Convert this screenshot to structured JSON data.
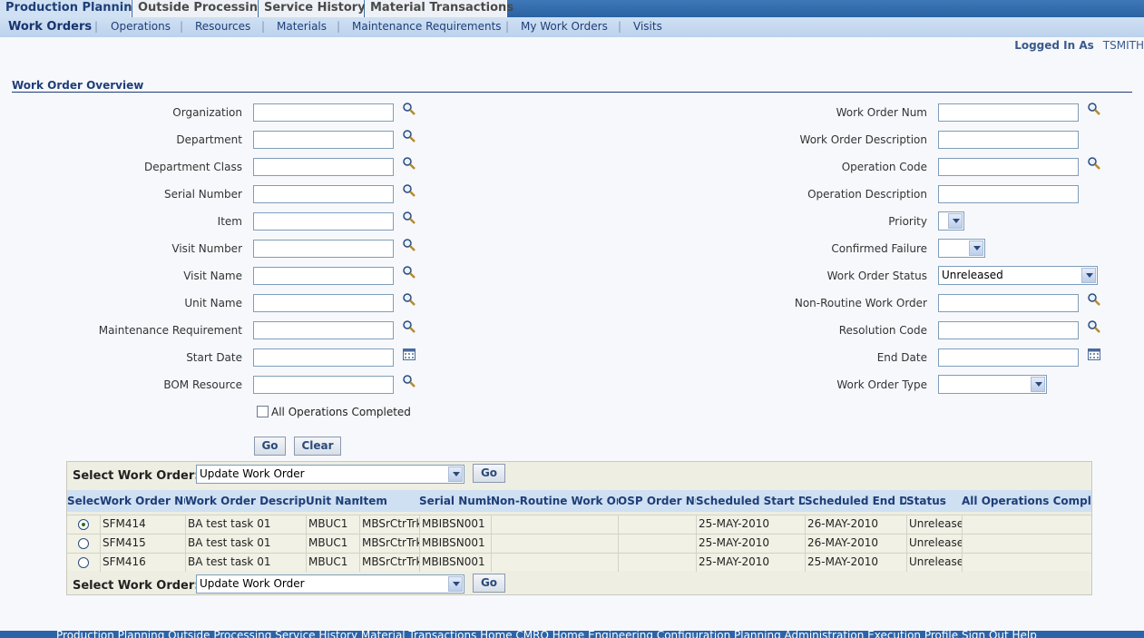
{
  "tabs": [
    {
      "label": "Production Planning",
      "active": true
    },
    {
      "label": "Outside Processing",
      "active": false
    },
    {
      "label": "Service History",
      "active": false
    },
    {
      "label": "Material Transactions",
      "active": false
    }
  ],
  "subnav": [
    "Work Orders",
    "Operations",
    "Resources",
    "Materials",
    "Maintenance Requirements",
    "My Work Orders",
    "Visits"
  ],
  "logged_in": {
    "label": "Logged In As",
    "user": "TSMITH"
  },
  "section_title": "Work Order Overview",
  "form_left": [
    {
      "label": "Organization",
      "icon": "search-icon"
    },
    {
      "label": "Department",
      "icon": "search-icon"
    },
    {
      "label": "Department Class",
      "icon": "search-icon"
    },
    {
      "label": "Serial Number",
      "icon": "search-icon"
    },
    {
      "label": "Item",
      "icon": "search-icon"
    },
    {
      "label": "Visit Number",
      "icon": "search-icon"
    },
    {
      "label": "Visit Name",
      "icon": "search-icon"
    },
    {
      "label": "Unit Name",
      "icon": "search-icon"
    },
    {
      "label": "Maintenance Requirement",
      "icon": "search-icon"
    },
    {
      "label": "Start Date",
      "icon": "calendar-icon"
    },
    {
      "label": "BOM Resource",
      "icon": "search-icon"
    }
  ],
  "form_right": {
    "work_order_num": "Work Order Num",
    "work_order_description": "Work Order Description",
    "operation_code": "Operation Code",
    "operation_description": "Operation Description",
    "priority": "Priority",
    "confirmed_failure": "Confirmed Failure",
    "work_order_status": "Work Order Status",
    "work_order_status_value": "Unreleased",
    "non_routine_work_order": "Non-Routine Work Order",
    "resolution_code": "Resolution Code",
    "end_date": "End Date",
    "work_order_type": "Work Order Type"
  },
  "all_operations_completed": "All Operations Completed",
  "buttons": {
    "go": "Go",
    "clear": "Clear"
  },
  "results": {
    "select_label": "Select Work Order:",
    "select_value": "Update Work Order",
    "go": "Go",
    "columns": [
      "Select",
      "Work Order Num",
      "Work Order Description",
      "Unit Name",
      "Item",
      "Serial Number",
      "Non-Routine Work Order",
      "OSP Order Num",
      "Scheduled Start Date",
      "Scheduled End Date",
      "Status",
      "All Operations Completed"
    ],
    "rows": [
      {
        "selected": true,
        "num": "SFM414",
        "desc": "BA test task 01",
        "unit": "MBUC1",
        "item": "MBSrCtrTrk.",
        "serial": "MBIBSN001",
        "nonroutine": "",
        "osp": "",
        "start": "25-MAY-2010",
        "end": "26-MAY-2010",
        "status": "Unreleased",
        "allops": ""
      },
      {
        "selected": false,
        "num": "SFM415",
        "desc": "BA test task 01",
        "unit": "MBUC1",
        "item": "MBSrCtrTrk.",
        "serial": "MBIBSN001",
        "nonroutine": "",
        "osp": "",
        "start": "25-MAY-2010",
        "end": "26-MAY-2010",
        "status": "Unreleased",
        "allops": ""
      },
      {
        "selected": false,
        "num": "SFM416",
        "desc": "BA test task 01",
        "unit": "MBUC1",
        "item": "MBSrCtrTrk.",
        "serial": "MBIBSN001",
        "nonroutine": "",
        "osp": "",
        "start": "25-MAY-2010",
        "end": "25-MAY-2010",
        "status": "Unreleased",
        "allops": ""
      }
    ]
  },
  "footer": "Production Planning   Outside Processing   Service History   Material Transactions   Home   CMRO Home   Engineering   Configuration   Planning   Administration   Execution   Profile   Sign Out   Help"
}
